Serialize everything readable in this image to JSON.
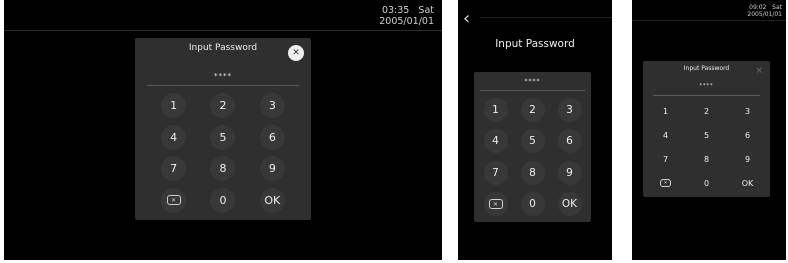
{
  "screen1": {
    "clock": {
      "time": "03:35",
      "day": "Sat",
      "date": "2005/01/01"
    },
    "dialog": {
      "title": "Input Password",
      "masked": "****"
    },
    "close_glyph": "✕"
  },
  "screen2": {
    "back_glyph": "‹",
    "title": "Input Password",
    "masked": "****"
  },
  "screen3": {
    "clock": {
      "time": "09:02",
      "day": "Sat",
      "date": "2005/01/01"
    },
    "dialog": {
      "title": "Input Password",
      "masked": "****"
    },
    "close_glyph": "×"
  },
  "keypad": {
    "keys": [
      "1",
      "2",
      "3",
      "4",
      "5",
      "6",
      "7",
      "8",
      "9",
      "backspace",
      "0",
      "OK"
    ],
    "digits": {
      "k1": "1",
      "k2": "2",
      "k3": "3",
      "k4": "4",
      "k5": "5",
      "k6": "6",
      "k7": "7",
      "k8": "8",
      "k9": "9",
      "k0": "0"
    },
    "ok_label": "OK",
    "backspace_glyph": "✕"
  },
  "colors": {
    "screen_bg": "#000000",
    "dialog_bg": "#2f2f2f",
    "key_bg": "#383838",
    "text": "#eeeeee"
  }
}
